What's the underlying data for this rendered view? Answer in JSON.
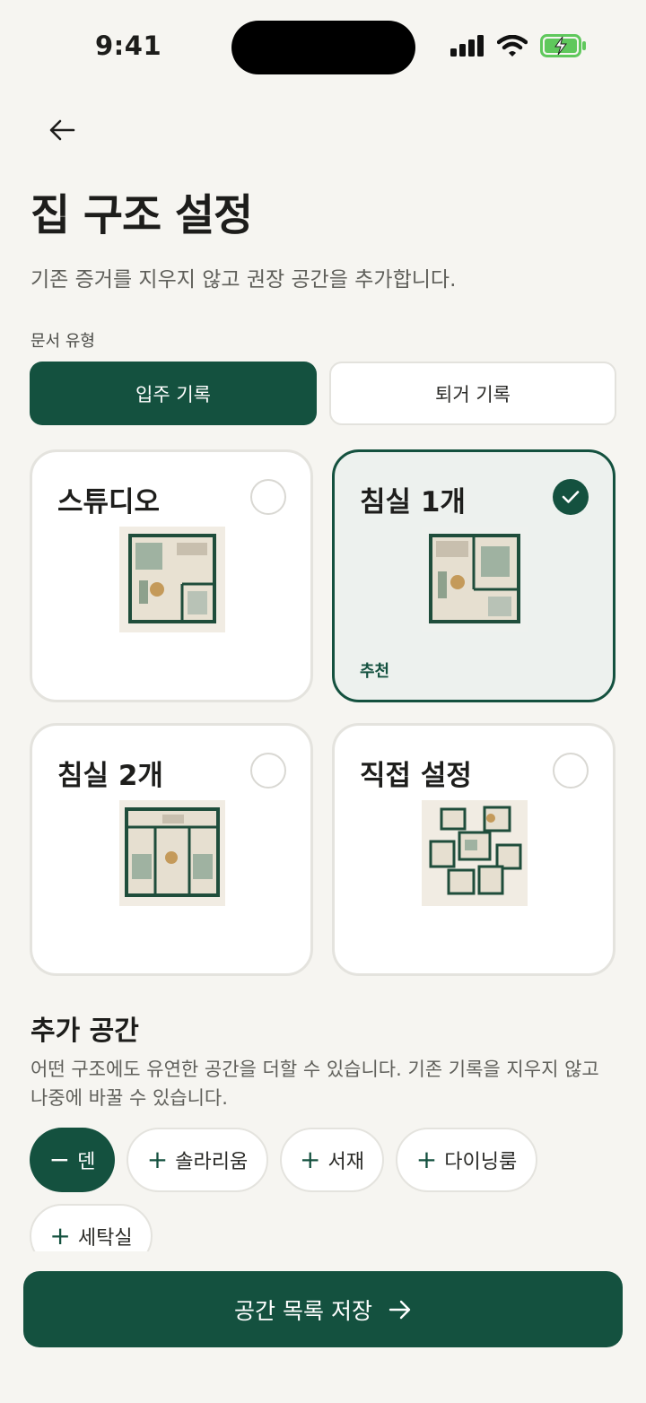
{
  "status_bar": {
    "time": "9:41"
  },
  "header": {
    "title": "집 구조 설정",
    "subtitle": "기존 증거를 지우지 않고 권장 공간을 추가합니다."
  },
  "document_type": {
    "label": "문서 유형",
    "options": [
      {
        "label": "입주 기록",
        "selected": true
      },
      {
        "label": "퇴거 기록",
        "selected": false
      }
    ]
  },
  "layouts": [
    {
      "title": "스튜디오",
      "selected": false,
      "badge": ""
    },
    {
      "title": "침실 1개",
      "selected": true,
      "badge": "추천"
    },
    {
      "title": "침실 2개",
      "selected": false,
      "badge": ""
    },
    {
      "title": "직접 설정",
      "selected": false,
      "badge": ""
    }
  ],
  "extra_spaces": {
    "title": "추가 공간",
    "description": "어떤 구조에도 유연한 공간을 더할 수 있습니다. 기존 기록을 지우지 않고 나중에 바꿀 수 있습니다.",
    "chips": [
      {
        "label": "덴",
        "added": true
      },
      {
        "label": "솔라리움",
        "added": false
      },
      {
        "label": "서재",
        "added": false
      },
      {
        "label": "다이닝룸",
        "added": false
      },
      {
        "label": "세탁실",
        "added": false
      }
    ]
  },
  "cta": {
    "label": "공간 목록 저장"
  },
  "colors": {
    "primary": "#14513f",
    "background": "#f6f5f1",
    "battery": "#5fc85c"
  }
}
